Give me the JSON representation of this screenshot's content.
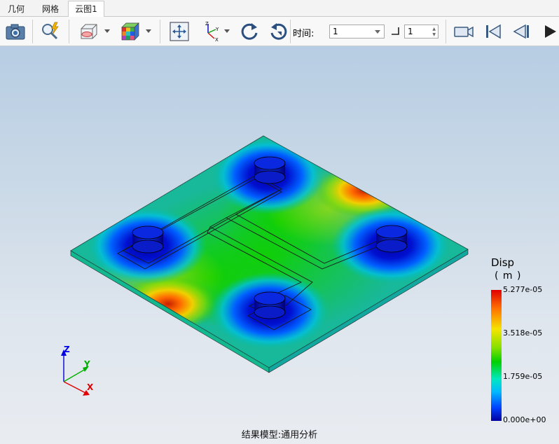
{
  "tabs": [
    {
      "label": "几何"
    },
    {
      "label": "网格"
    },
    {
      "label": "云图1"
    }
  ],
  "toolbar": {
    "time_label": "时间:",
    "time_value": "1",
    "step_value": "1",
    "icons": [
      "camera-icon",
      "query-icon",
      "section-plane-icon",
      "color-cube-icon",
      "fit-view-icon",
      "axes-icon",
      "rotate-left-icon",
      "rotate-right-icon",
      "record-icon",
      "first-frame-icon",
      "prev-frame-icon",
      "next-frame-icon"
    ]
  },
  "legend": {
    "title": "Disp",
    "unit": "( m )",
    "ticks": [
      "5.277e-05",
      "3.518e-05",
      "1.759e-05",
      "0.000e+00"
    ],
    "colors": [
      "#e00000",
      "#f5e400",
      "#00d000",
      "#00e8c0",
      "#0000a0"
    ]
  },
  "triad": {
    "x": "X",
    "y": "Y",
    "z": "Z",
    "x_color": "#e00000",
    "y_color": "#00b000",
    "z_color": "#0000e0"
  },
  "status": "结果模型:通用分析"
}
